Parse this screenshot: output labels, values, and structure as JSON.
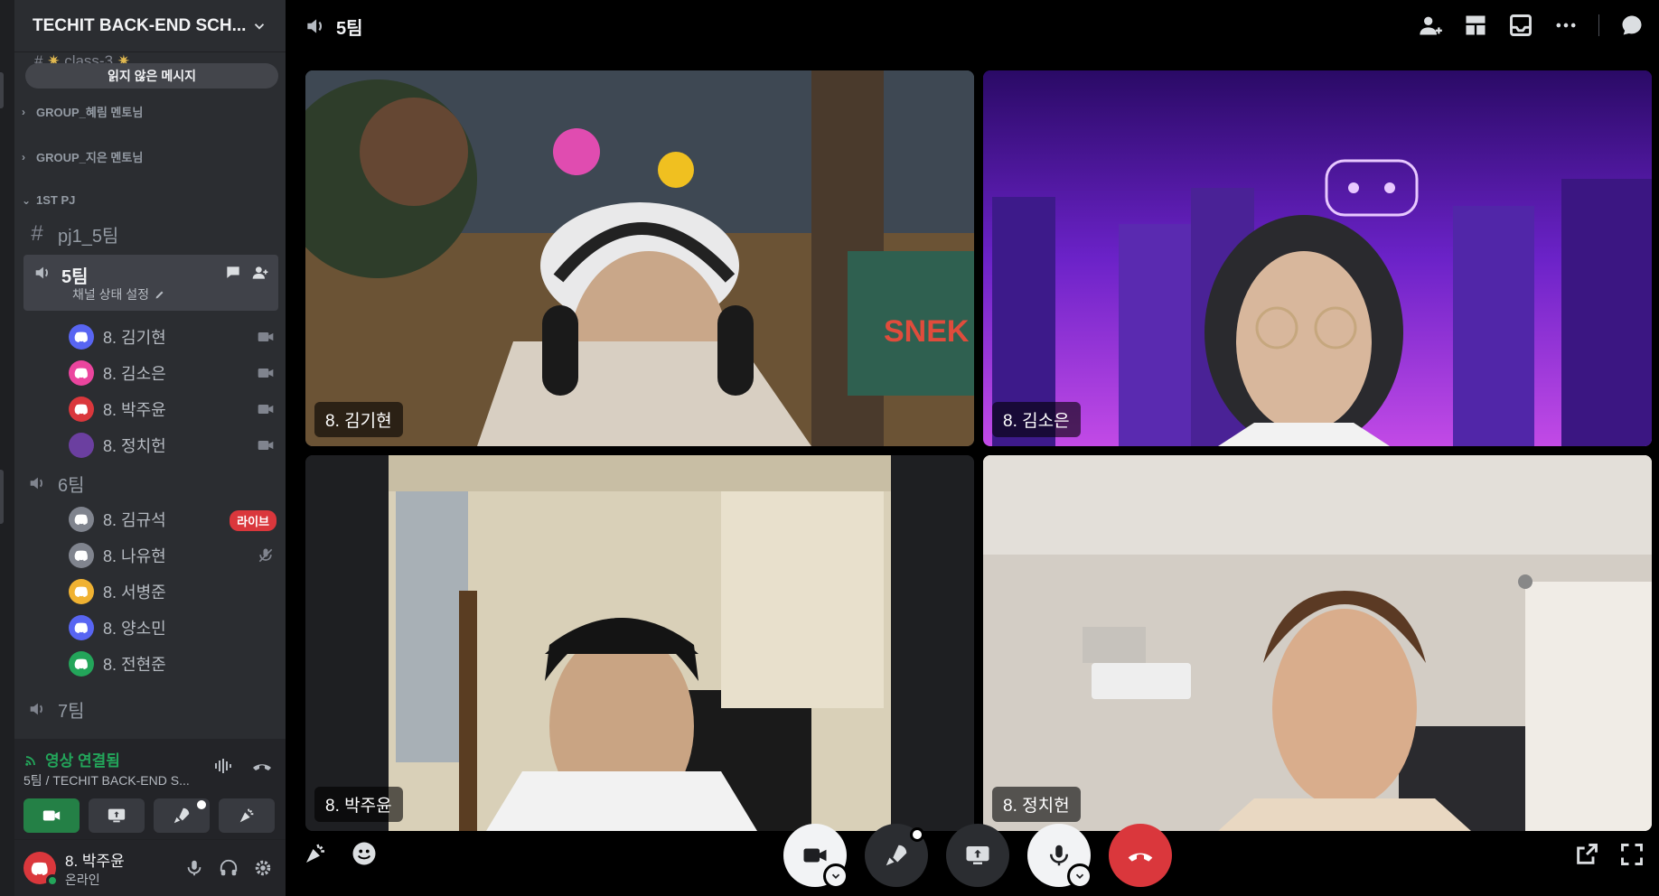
{
  "server": {
    "name": "TECHIT BACK-END SCH..."
  },
  "faded_channel": "class-3",
  "unread_pill": "읽지 않은 메시지",
  "categories": [
    {
      "label": "GROUP_혜림 멘토님",
      "collapsed": true
    },
    {
      "label": "GROUP_지은 멘토님",
      "collapsed": true
    },
    {
      "label": "1ST PJ",
      "collapsed": false
    }
  ],
  "text_channel": {
    "name": "pj1_5팀"
  },
  "active_voice": {
    "name": "5팀",
    "status": "채널 상태 설정",
    "members": [
      {
        "name": "8. 김기현",
        "avatar_color": "#5865f2"
      },
      {
        "name": "8. 김소은",
        "avatar_color": "#eb459e"
      },
      {
        "name": "8. 박주윤",
        "avatar_color": "#da373c"
      },
      {
        "name": "8. 정치헌",
        "avatar_color": "#6b3fa0"
      }
    ]
  },
  "voice_team6": {
    "name": "6팀",
    "members": [
      {
        "name": "8. 김규석",
        "avatar_color": "#5865f2",
        "badge": "라이브"
      },
      {
        "name": "8. 나유현",
        "avatar_color": "#5865f2"
      },
      {
        "name": "8. 서병준",
        "avatar_color": "#f0b232"
      },
      {
        "name": "8. 양소민",
        "avatar_color": "#5865f2"
      },
      {
        "name": "8. 전현준",
        "avatar_color": "#23a55a"
      }
    ]
  },
  "voice_team7": {
    "name": "7팀"
  },
  "voice_panel": {
    "status": "영상 연결됨",
    "sub": "5팀 / TECHIT BACK-END S..."
  },
  "user": {
    "name": "8. 박주윤",
    "status": "온라인"
  },
  "topbar": {
    "channel_title": "5팀"
  },
  "tiles": [
    {
      "name": "8. 김기현"
    },
    {
      "name": "8. 김소은"
    },
    {
      "name": "8. 박주윤"
    },
    {
      "name": "8. 정치헌"
    }
  ],
  "colors": {
    "accent_green": "#23a55a",
    "danger": "#da373c",
    "blurple": "#5865f2"
  }
}
